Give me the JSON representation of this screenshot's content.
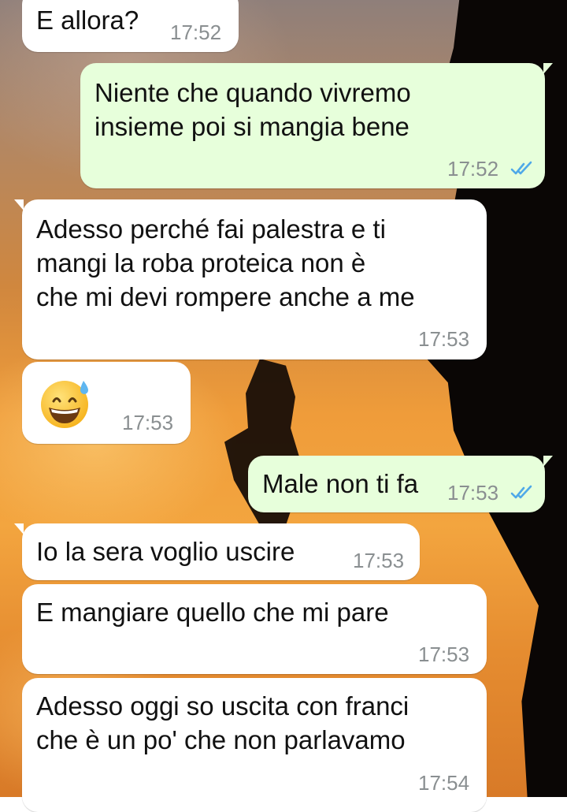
{
  "colors": {
    "incoming_bubble": "#ffffff",
    "outgoing_bubble": "#e7ffdb",
    "timestamp": "#8a8f91",
    "read_ticks": "#4fa9e8"
  },
  "messages": [
    {
      "direction": "incoming",
      "text": "E allora?",
      "time": "17:52"
    },
    {
      "direction": "outgoing",
      "text": "Niente che quando vivremo\ninsieme poi si mangia bene",
      "time": "17:52",
      "status_icon": "double-check-read-icon"
    },
    {
      "direction": "incoming",
      "text": "Adesso perché fai palestra e ti\nmangi la roba proteica non è\nche mi devi rompere anche a me",
      "time": "17:53"
    },
    {
      "direction": "incoming",
      "emoji": "grinning-face-with-sweat-emoji",
      "time": "17:53"
    },
    {
      "direction": "outgoing",
      "text": "Male non ti fa",
      "time": "17:53",
      "status_icon": "double-check-read-icon"
    },
    {
      "direction": "incoming",
      "text": "Io la sera voglio uscire",
      "time": "17:53"
    },
    {
      "direction": "incoming",
      "text": "E mangiare quello che mi pare",
      "time": "17:53"
    },
    {
      "direction": "incoming",
      "text": "Adesso oggi so uscita con franci\nche è un po' che non parlavamo",
      "time": "17:54"
    }
  ]
}
